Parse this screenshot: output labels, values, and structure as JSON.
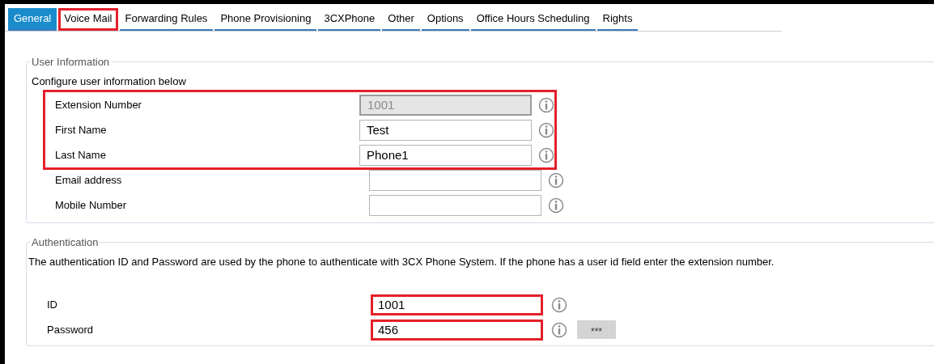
{
  "tabs": [
    {
      "label": "General",
      "selected": true,
      "highlighted": false
    },
    {
      "label": "Voice Mail",
      "selected": false,
      "highlighted": true
    },
    {
      "label": "Forwarding Rules",
      "selected": false,
      "highlighted": false
    },
    {
      "label": "Phone Provisioning",
      "selected": false,
      "highlighted": false
    },
    {
      "label": "3CXPhone",
      "selected": false,
      "highlighted": false
    },
    {
      "label": "Other",
      "selected": false,
      "highlighted": false
    },
    {
      "label": "Options",
      "selected": false,
      "highlighted": false
    },
    {
      "label": "Office Hours Scheduling",
      "selected": false,
      "highlighted": false
    },
    {
      "label": "Rights",
      "selected": false,
      "highlighted": false
    }
  ],
  "user_information": {
    "title": "User Information",
    "description": "Configure user information below",
    "fields": [
      {
        "label": "Extension Number",
        "value": "1001",
        "disabled": true,
        "highlighted": true
      },
      {
        "label": "First Name",
        "value": "Test",
        "disabled": false,
        "highlighted": true
      },
      {
        "label": "Last Name",
        "value": "Phone1",
        "disabled": false,
        "highlighted": true
      },
      {
        "label": "Email address",
        "disabled": false,
        "highlighted": false
      },
      {
        "label": "Mobile Number",
        "disabled": false,
        "highlighted": false
      }
    ]
  },
  "authentication": {
    "title": "Authentication",
    "description": "The authentication ID and Password are used by the phone to authenticate with 3CX Phone System. If the phone has a user id field enter the extension number.",
    "fields": [
      {
        "label": "ID",
        "value": "1001",
        "highlighted": true
      },
      {
        "label": "Password",
        "value": "456",
        "highlighted": true,
        "reveal_button": "***"
      }
    ]
  }
}
